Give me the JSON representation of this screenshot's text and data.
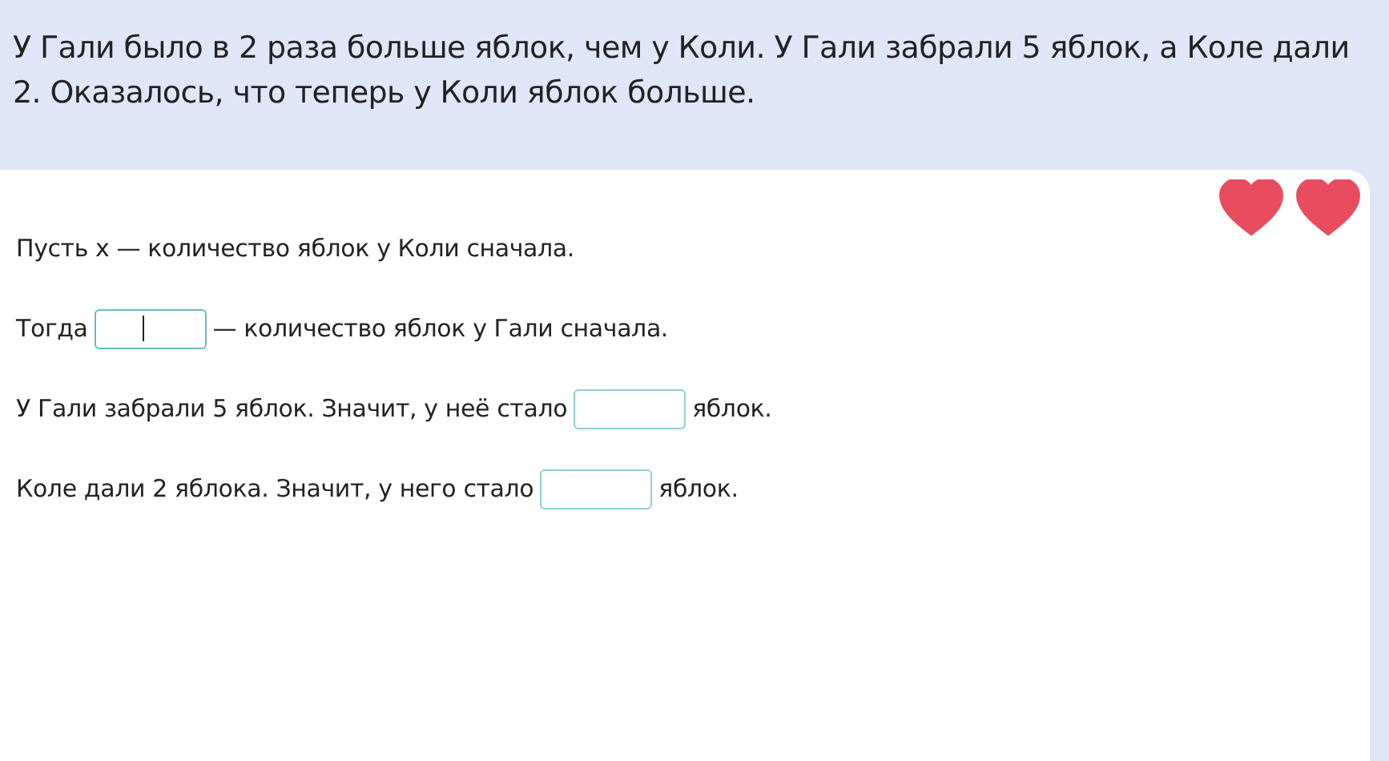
{
  "task": {
    "text": "У Гали было в 2 раза больше яблок, чем у Коли. У Гали забрали 5 яблок, а Коле дали 2. Оказалось, что теперь у Коли яблок больше."
  },
  "hearts": [
    {
      "filled": true
    },
    {
      "filled": true
    }
  ],
  "lines": [
    {
      "parts": [
        {
          "kind": "text",
          "text": "Пусть x — количество яблок у Коли сначала."
        }
      ]
    },
    {
      "parts": [
        {
          "kind": "text",
          "text": "Тогда"
        },
        {
          "kind": "field",
          "focused": true
        },
        {
          "kind": "text",
          "text": "— количество яблок у Гали сначала."
        }
      ]
    },
    {
      "parts": [
        {
          "kind": "text",
          "text": "У Гали забрали 5 яблок. Значит, у неё стало"
        },
        {
          "kind": "field",
          "focused": false
        },
        {
          "kind": "text",
          "text": "яблок."
        }
      ]
    },
    {
      "parts": [
        {
          "kind": "text",
          "text": "Коле дали 2 яблока. Значит, у него стало"
        },
        {
          "kind": "field",
          "focused": false
        },
        {
          "kind": "text",
          "text": "яблок."
        }
      ]
    }
  ]
}
